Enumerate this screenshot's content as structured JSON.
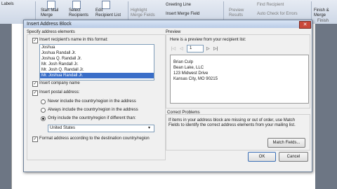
{
  "ribbon": {
    "labels": "Labels",
    "start_mail": "Start Mail\nMerge",
    "select": "Select\nRecipients",
    "edit": "Edit\nRecipient List",
    "highlight": "Highlight\nMerge Fields",
    "greeting": "Greeting Line",
    "insert_merge": "Insert Merge Field",
    "preview": "Preview\nResults",
    "find_recipient": "Find Recipient",
    "auto_check": "Auto Check for Errors",
    "finish": "Finish &\nMerge",
    "finish_group": "Finish"
  },
  "dialog": {
    "title": "Insert Address Block",
    "close": "✕",
    "specify": {
      "heading": "Specify address elements",
      "insert_name_label": "Insert recipient's name in this format:",
      "insert_name_checked": true,
      "name_formats": [
        "Joshua",
        "Joshua Randall Jr.",
        "Joshua Q. Randall Jr.",
        "Mr. Josh Randall Jr.",
        "Mr. Josh Q. Randall Jr.",
        "Mr. Joshua Randall Jr."
      ],
      "selected_index": 5,
      "insert_company_label": "Insert company name",
      "insert_company_checked": true,
      "insert_postal_label": "Insert postal address:",
      "insert_postal_checked": true,
      "radio_never": "Never include the country/region in the address",
      "radio_always": "Always include the country/region in the address",
      "radio_only": "Only include the country/region if different than:",
      "selected_radio": "only",
      "country": "United States",
      "format_label": "Format address according to the destination country/region",
      "format_checked": true
    },
    "preview": {
      "heading": "Preview",
      "subheading": "Here is a preview from your recipient list:",
      "record": "1",
      "address_lines": [
        "Brian Culp",
        "Bean Lake, LLC",
        "123 Midwest Drive",
        "Kansas City, MO 90215"
      ]
    },
    "problems": {
      "heading": "Correct Problems",
      "text": "If items in your address block are missing or out of order, use Match Fields to identify the correct address elements from your mailing list.",
      "match_fields": "Match Fields..."
    },
    "ok": "OK",
    "cancel": "Cancel"
  }
}
